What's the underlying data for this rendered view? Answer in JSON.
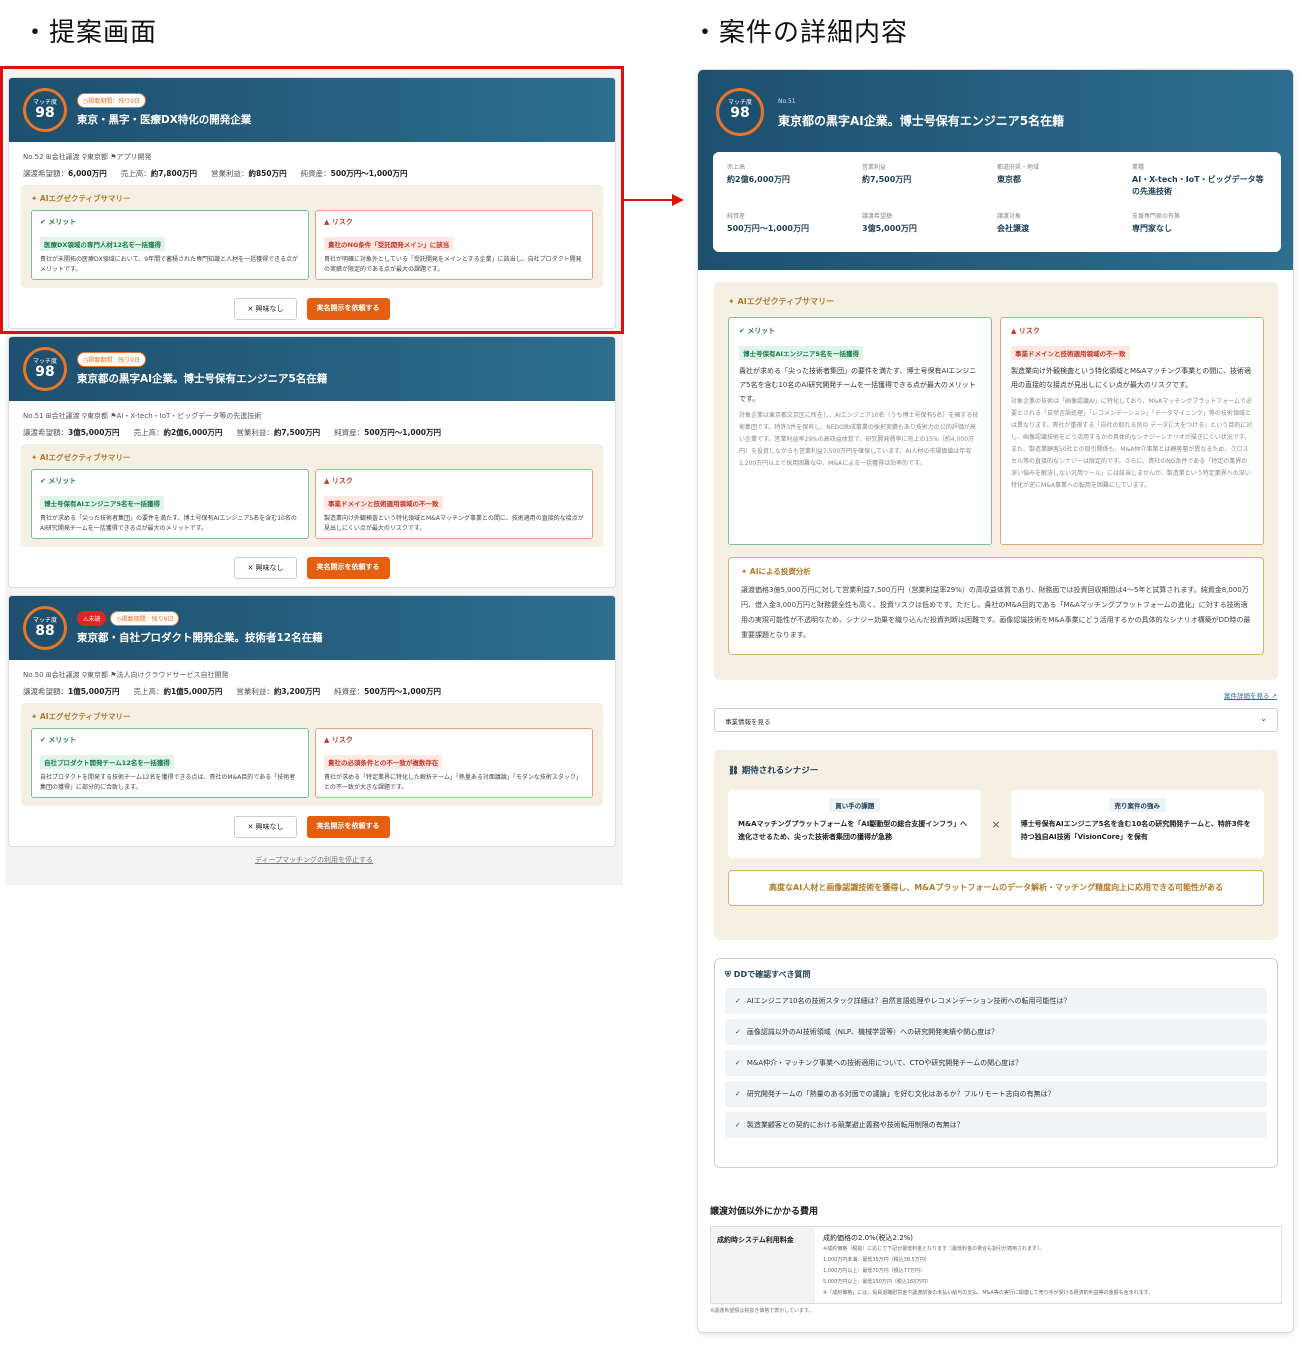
{
  "headings": {
    "left": "・提案画面",
    "right": "・案件の詳細内容"
  },
  "cards": [
    {
      "match_label": "マッチ度",
      "score": "98",
      "badges": [
        "◷掲載期間：残り9日"
      ],
      "title": "東京・黒字・医療DX特化の開発企業",
      "meta": "No.52  ⊞会社譲渡  ⚲東京都  ⚑アプリ開発",
      "fin": [
        {
          "k": "譲渡希望額：",
          "v": "6,000万円"
        },
        {
          "k": "売上高：",
          "v": "約7,800万円"
        },
        {
          "k": "営業利益：",
          "v": "約850万円"
        },
        {
          "k": "純資産：",
          "v": "500万円〜1,000万円"
        }
      ],
      "merit_hl": "医療DX領域の専門人材12名を一括獲得",
      "merit_body": "貴社が未開拓の医療DX領域において、9年間で蓄積された専門知識と人材を一括獲得できる点がメリットです。",
      "risk_hl": "貴社のNG条件「受託開発メイン」に該当",
      "risk_body": "貴社が明確に対象外としている「受託開発をメインとする企業」に該当し、自社プロダクト開発の実績が限定的である点が最大の課題です。"
    },
    {
      "match_label": "マッチ度",
      "score": "98",
      "badges": [
        "◷掲載期間：残り9日"
      ],
      "title": "東京都の黒字AI企業。博士号保有エンジニア5名在籍",
      "meta": "No.51  ⊞会社譲渡  ⚲東京都  ⚑AI・X-tech・IoT・ビッグデータ等の先進技術",
      "fin": [
        {
          "k": "譲渡希望額：",
          "v": "3億5,000万円"
        },
        {
          "k": "売上高：",
          "v": "約2億6,000万円"
        },
        {
          "k": "営業利益：",
          "v": "約7,500万円"
        },
        {
          "k": "純資産：",
          "v": "500万円〜1,000万円"
        }
      ],
      "merit_hl": "博士号保有AIエンジニア5名を一括獲得",
      "merit_body": "貴社が求める「尖った技術者集団」の要件を満たす、博士号保有AIエンジニア5名を含む10名のAI研究開発チームを一括獲得できる点が最大のメリットです。",
      "risk_hl": "事業ドメインと技術適用領域の不一致",
      "risk_body": "製造業向け外観検査という特化領域とM&Aマッチング事業との間に、技術適用の直接的な接点が見出しにくい点が最大のリスクです。"
    },
    {
      "match_label": "マッチ度",
      "score": "88",
      "badges": [
        "⚠未読",
        "◷掲載期間：残り9日"
      ],
      "title": "東京都・自社プロダクト開発企業。技術者12名在籍",
      "meta": "No.50  ⊞会社譲渡  ⚲東京都  ⚑法人向けクラウドサービス自社開発",
      "fin": [
        {
          "k": "譲渡希望額：",
          "v": "1億5,000万円"
        },
        {
          "k": "売上高：",
          "v": "約1億5,000万円"
        },
        {
          "k": "営業利益：",
          "v": "約3,200万円"
        },
        {
          "k": "純資産：",
          "v": "500万円〜1,000万円"
        }
      ],
      "merit_hl": "自社プロダクト開発チーム12名を一括獲得",
      "merit_body": "自社プロダクトを開発する技術チーム12名を獲得できる点は、貴社のM&A目的である「技術者集団の獲得」に部分的に合致します。",
      "risk_hl": "貴社の必須条件との不一致が複数存在",
      "risk_body": "貴社が求める「特定業界に特化した解析チーム」「熱量ある対面議論」「モダンな技術スタック」との不一致が大きな課題です。"
    }
  ],
  "common": {
    "summary_title": "AIエグゼクティブサマリー",
    "merit": "メリット",
    "risk": "リスク",
    "btn_no": "✕ 興味なし",
    "btn_yes": "実名開示を依頼する",
    "stop": "ディープマッチングの利用を停止する"
  },
  "detail": {
    "no": "No.51",
    "title": "東京都の黒字AI企業。博士号保有エンジニア5名在籍",
    "match_label": "マッチ度",
    "score": "98",
    "info": [
      {
        "k": "売上高",
        "v": "約2億6,000万円"
      },
      {
        "k": "営業利益",
        "v": "約7,500万円"
      },
      {
        "k": "都道府県・地域",
        "v": "東京都"
      },
      {
        "k": "業種",
        "v": "AI・X-tech・IoT・ビッグデータ等の先進技術"
      },
      {
        "k": "純資産",
        "v": "500万円〜1,000万円"
      },
      {
        "k": "譲渡希望額",
        "v": "3億5,000万円"
      },
      {
        "k": "譲渡対象",
        "v": "会社譲渡"
      },
      {
        "k": "支援専門家の有無",
        "v": "専門家なし"
      }
    ],
    "merit_hl": "博士号保有AIエンジニア5名を一括獲得",
    "merit_body": "貴社が求める「尖った技術者集団」の要件を満たす、博士号保有AIエンジニア5名を含む10名のAI研究開発チームを一括獲得できる点が最大のメリットです。",
    "merit_fine": "対象企業は東京都文京区に所在し、AIエンジニア10名（うち博士号保有5名）を擁する技術集団です。特許3件を保有し、NEDO助成事業の採択実績もあり技術力の公的評価が高い企業です。営業利益率29%の高収益体質で、研究開発費率に売上の15%（約4,000万円）を投資しながらも営業利益7,500万円を確保しています。AI人材の市場価値は年収1,200万円以上で採用困難な中、M&Aによる一括獲得は効率的です。",
    "risk_hl": "事業ドメインと技術適用領域の不一致",
    "risk_body": "製造業向け外観検査という特化領域とM&Aマッチング事業との間に、技術適用の直接的な接点が見出しにくい点が最大のリスクです。",
    "risk_fine": "対象企業の技術は「画像認識AI」に特化しており、M&Aマッチングプラットフォームで必要とされる「自然言語処理」「レコメンデーション」「データマイニング」等の技術領域とは異なります。貴社が重視する「自社の取れる良の データに大をつける」という目的に対し、画像認識技術をどう活用するかの具体的なシナジーシナリオが描きにくい状況です。また、製造業顧客50社との取引関係も、M&A仲介事業とは顧客層が異なるため、クロスセル等の直接的なシナジーは限定的です。さらに、貴社のNG条件である「特定の業界の深い悩みを解決しない汎用ツール」には該当しませんが、製造業という特定業界への深い特化が逆にM&A事業への転用を困難にしています。",
    "inv_title": "AIによる投資分析",
    "inv_body": "譲渡価格3億5,000万円に対して営業利益7,500万円（営業利益率29%）の高収益体質であり、財務面では投資回収期間は4〜5年と試算されます。純資金8,000万円、借入金3,000万円と財務健全性も高く、投資リスクは低めです。ただし、貴社のM&A目的である「M&Aマッチングプラットフォームの進化」に対する技術適用の実現可能性が不透明なため、シナジー効果を織り込んだ投資判断は困難です。画像認識技術をM&A事業にどう活用するかの具体的なシナリオ構築がDD時の最重要課題となります。",
    "link": "案件詳細を見る ↗",
    "dropdown": "事業情報を見る",
    "dd_chev": "⌄",
    "syn_title": "期待されるシナジー",
    "buyer_h": "買い手の課題",
    "buyer": "M&Aマッチングプラットフォームを「AI駆動型の総合支援インフラ」へ進化させるため、尖った技術者集団の獲得が急務",
    "seller_h": "売り案件の強み",
    "seller": "博士号保有AIエンジニア5名を含む10名の研究開発チームと、特許3件を持つ独自AI技術「VisionCore」を保有",
    "syn_concl": "高度なAI人材と画像認識技術を獲得し、M&Aプラットフォームのデータ解析・マッチング精度向上に応用できる可能性がある",
    "q_title": "DDで確認すべき質問",
    "questions": [
      "AIエンジニア10名の技術スタック詳細は？自然言語処理やレコメンデーション技術への転用可能性は？",
      "画像認識以外のAI技術領域（NLP、機械学習等）への研究開発実績や関心度は？",
      "M&A仲介・マッチング事業への技術適用について、CTOや研究開発チームの関心度は？",
      "研究開発チームの「熱量のある対面での議論」を好む文化はあるか？フルリモート志向の有無は？",
      "製造業顧客との契約における競業避止義務や技術転用制限の有無は？"
    ],
    "fee_title": "譲渡対価以外にかかる費用",
    "fee_k": "成約時システム利用料金",
    "fee_v": "成約価格の2.0%(税込2.2%)",
    "fee_s1": "※成約価格（税抜）に応じて下記が最低料金となります（最低料金の場合も割引が適用されます）。",
    "fee_s2": "1,000万円未満：最低35万円（税込38.5万円）",
    "fee_s3": "1,000万円以上：最低70万円（税込77万円）",
    "fee_s4": "5,000万円以上：最低150万円（税込165万円）",
    "fee_s5": "※「成約価格」には、役員退職慰労金や譲渡前後の未払い給与の支払、M&A等の実行に関連して売り手が受ける経済的利益等の金額も含まれます。",
    "note": "※譲渡希望額は税抜き価格で表示しています。"
  },
  "colors": {
    "header": "#1e4f6e",
    "accent": "#e45f12",
    "frame": "#e01010"
  }
}
